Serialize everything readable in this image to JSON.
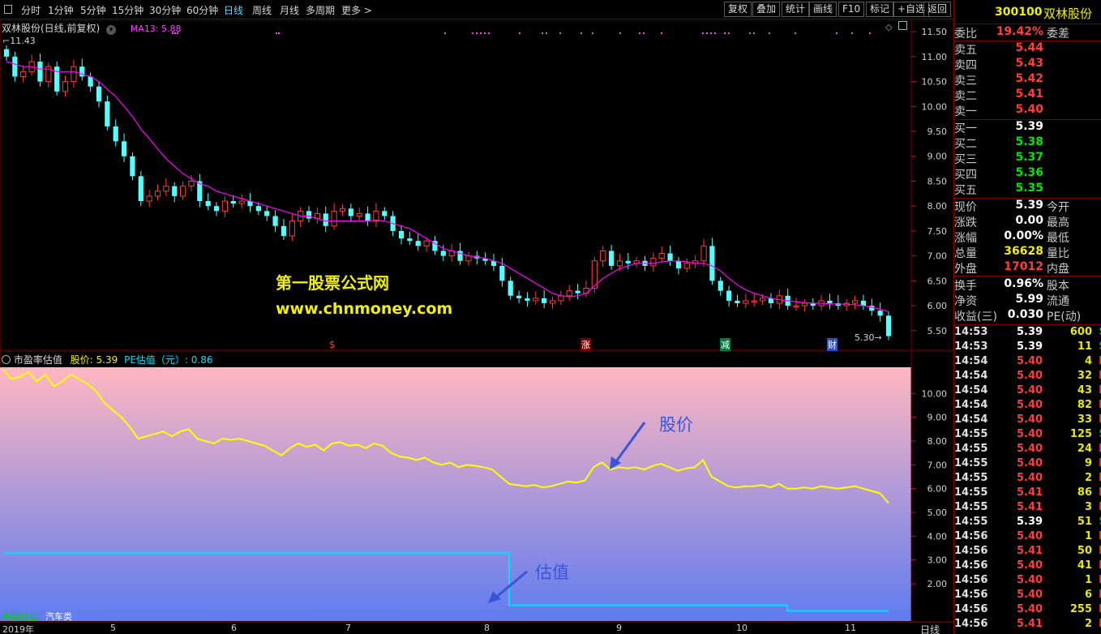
{
  "toolbar": {
    "periods": [
      "分时",
      "1分钟",
      "5分钟",
      "15分钟",
      "30分钟",
      "60分钟",
      "日线",
      "周线",
      "月线",
      "多周期",
      "更多 >"
    ],
    "active_period": "日线",
    "right_buttons": [
      "复权",
      "叠加",
      "统计",
      "画线",
      "F10",
      "标记",
      "+自选",
      "返回"
    ]
  },
  "main_header": {
    "stock_label": "双林股份(日线,前复权)",
    "ma_label": "MA13: 5.88",
    "high_label": "11.43",
    "low_label": "5.30"
  },
  "watermark": {
    "line1": "第一股票公式网",
    "line2": "www.chnmoney.com"
  },
  "event_marks": [
    "$",
    "涨",
    "减",
    "财"
  ],
  "indicator_header": {
    "name": "市盈率估值",
    "price_label": "股价: 5.39",
    "pe_label": "PE估值（元）: 0.86"
  },
  "annotations": {
    "price": "股价",
    "valuation": "估值"
  },
  "industry": {
    "label": "所属行业",
    "value": "汽车类"
  },
  "x_axis": {
    "period": "日线",
    "labels": [
      "2019年",
      "5",
      "6",
      "7",
      "8",
      "9",
      "10",
      "11"
    ]
  },
  "stock_head": {
    "code": "300100",
    "name": "双林股份"
  },
  "weibi": {
    "label": "委比",
    "value": "19.42%",
    "right_label": "委差"
  },
  "asks": [
    {
      "label": "卖五",
      "price": "5.44"
    },
    {
      "label": "卖四",
      "price": "5.43"
    },
    {
      "label": "卖三",
      "price": "5.42"
    },
    {
      "label": "卖二",
      "price": "5.41"
    },
    {
      "label": "卖一",
      "price": "5.40"
    }
  ],
  "bids": [
    {
      "label": "买一",
      "price": "5.39"
    },
    {
      "label": "买二",
      "price": "5.38"
    },
    {
      "label": "买三",
      "price": "5.37"
    },
    {
      "label": "买四",
      "price": "5.36"
    },
    {
      "label": "买五",
      "price": "5.35"
    }
  ],
  "stats": [
    {
      "label": "现价",
      "value": "5.39",
      "right": "今开"
    },
    {
      "label": "涨跌",
      "value": "0.00",
      "right": "最高"
    },
    {
      "label": "涨幅",
      "value": "0.00%",
      "right": "最低"
    },
    {
      "label": "总量",
      "value": "36628",
      "right": "量比"
    },
    {
      "label": "外盘",
      "value": "17012",
      "right": "内盘"
    }
  ],
  "fundamentals": [
    {
      "label": "换手",
      "value": "0.96%",
      "right": "股本"
    },
    {
      "label": "净资",
      "value": "5.99",
      "right": "流通"
    },
    {
      "label": "收益(三)",
      "value": "0.030",
      "right": "PE(动)"
    }
  ],
  "trades": [
    {
      "time": "14:53",
      "price": "5.39",
      "vol": "600",
      "dir": "S"
    },
    {
      "time": "14:53",
      "price": "5.39",
      "vol": "11",
      "dir": "S"
    },
    {
      "time": "14:54",
      "price": "5.40",
      "vol": "4",
      "dir": "B"
    },
    {
      "time": "14:54",
      "price": "5.40",
      "vol": "32",
      "dir": "B"
    },
    {
      "time": "14:54",
      "price": "5.40",
      "vol": "43",
      "dir": "B"
    },
    {
      "time": "14:54",
      "price": "5.40",
      "vol": "82",
      "dir": "B"
    },
    {
      "time": "14:54",
      "price": "5.40",
      "vol": "33",
      "dir": "B"
    },
    {
      "time": "14:55",
      "price": "5.40",
      "vol": "125",
      "dir": "S"
    },
    {
      "time": "14:55",
      "price": "5.40",
      "vol": "24",
      "dir": "B"
    },
    {
      "time": "14:55",
      "price": "5.40",
      "vol": "9",
      "dir": "B"
    },
    {
      "time": "14:55",
      "price": "5.40",
      "vol": "2",
      "dir": "B"
    },
    {
      "time": "14:55",
      "price": "5.41",
      "vol": "86",
      "dir": "B"
    },
    {
      "time": "14:55",
      "price": "5.41",
      "vol": "3",
      "dir": "B"
    },
    {
      "time": "14:55",
      "price": "5.39",
      "vol": "51",
      "dir": "S"
    },
    {
      "time": "14:56",
      "price": "5.40",
      "vol": "1",
      "dir": "B"
    },
    {
      "time": "14:56",
      "price": "5.41",
      "vol": "50",
      "dir": "B"
    },
    {
      "time": "14:56",
      "price": "5.40",
      "vol": "41",
      "dir": "B"
    },
    {
      "time": "14:56",
      "price": "5.40",
      "vol": "1",
      "dir": "B"
    },
    {
      "time": "14:56",
      "price": "5.40",
      "vol": "6",
      "dir": "B"
    },
    {
      "time": "14:56",
      "price": "5.40",
      "vol": "255",
      "dir": "B"
    },
    {
      "time": "14:56",
      "price": "5.41",
      "vol": "2",
      "dir": "B"
    }
  ],
  "colors": {
    "up": "#ff3c3c",
    "down": "#54ffff",
    "ma": "#ff00ff",
    "price_line": "#ffff00",
    "pe_line": "#00e0ff",
    "border": "#7a0000",
    "gradient_top": "#ffb6c1",
    "gradient_bottom": "#5f7cf0"
  },
  "chart_data": [
    {
      "type": "candlestick",
      "title": "双林股份(日线,前复权)",
      "series_name": "MA13",
      "y_ticks": [
        11.5,
        11.0,
        10.5,
        10.0,
        9.5,
        9.0,
        8.5,
        8.0,
        7.5,
        7.0,
        6.5,
        6.0,
        5.5
      ],
      "ylim": [
        5.35,
        11.6
      ],
      "x_labels": [
        "2019年",
        "5",
        "6",
        "7",
        "8",
        "9",
        "10",
        "11"
      ],
      "close": [
        11.0,
        10.6,
        10.7,
        10.9,
        10.5,
        10.8,
        10.3,
        10.5,
        10.8,
        10.6,
        10.4,
        10.1,
        9.6,
        9.3,
        9.0,
        8.6,
        8.1,
        8.2,
        8.3,
        8.4,
        8.2,
        8.4,
        8.5,
        8.1,
        8.0,
        7.9,
        8.1,
        8.05,
        8.1,
        8.0,
        7.9,
        7.8,
        7.6,
        7.4,
        7.7,
        7.9,
        7.75,
        7.85,
        7.6,
        7.9,
        7.95,
        7.8,
        7.85,
        7.7,
        7.9,
        7.8,
        7.5,
        7.35,
        7.3,
        7.2,
        7.3,
        7.1,
        7.0,
        7.1,
        6.9,
        7.0,
        6.95,
        6.9,
        6.8,
        6.5,
        6.2,
        6.15,
        6.1,
        6.15,
        6.05,
        6.1,
        6.2,
        6.3,
        6.25,
        6.35,
        6.9,
        7.1,
        6.8,
        6.9,
        6.85,
        6.9,
        6.8,
        6.95,
        7.05,
        6.9,
        6.75,
        6.85,
        6.9,
        7.2,
        6.5,
        6.3,
        6.1,
        6.05,
        6.1,
        6.1,
        6.15,
        6.05,
        6.2,
        6.0,
        6.0,
        6.05,
        6.0,
        6.1,
        6.05,
        6.0,
        6.05,
        6.1,
        6.0,
        5.9,
        5.8,
        5.39
      ],
      "ma13": [
        10.9,
        10.85,
        10.8,
        10.8,
        10.75,
        10.75,
        10.7,
        10.7,
        10.7,
        10.65,
        10.6,
        10.5,
        10.35,
        10.2,
        10.0,
        9.8,
        9.55,
        9.35,
        9.15,
        8.95,
        8.8,
        8.65,
        8.55,
        8.45,
        8.4,
        8.3,
        8.25,
        8.2,
        8.15,
        8.1,
        8.05,
        8.0,
        7.95,
        7.9,
        7.85,
        7.8,
        7.8,
        7.75,
        7.7,
        7.7,
        7.7,
        7.7,
        7.7,
        7.7,
        7.72,
        7.7,
        7.65,
        7.6,
        7.55,
        7.45,
        7.35,
        7.25,
        7.15,
        7.1,
        7.05,
        7.0,
        6.98,
        6.95,
        6.9,
        6.85,
        6.75,
        6.65,
        6.55,
        6.45,
        6.35,
        6.25,
        6.2,
        6.18,
        6.2,
        6.25,
        6.4,
        6.55,
        6.65,
        6.75,
        6.8,
        6.85,
        6.85,
        6.85,
        6.88,
        6.9,
        6.9,
        6.88,
        6.85,
        6.85,
        6.8,
        6.7,
        6.55,
        6.42,
        6.32,
        6.25,
        6.2,
        6.15,
        6.12,
        6.1,
        6.08,
        6.06,
        6.05,
        6.05,
        6.04,
        6.03,
        6.03,
        6.02,
        6.0,
        5.97,
        5.93,
        5.88
      ]
    },
    {
      "type": "line",
      "title": "市盈率估值",
      "y_ticks": [
        10.0,
        9.0,
        8.0,
        7.0,
        6.0,
        5.0,
        4.0,
        3.0,
        2.0
      ],
      "ylim": [
        0.4,
        11.1
      ],
      "series": [
        {
          "name": "股价",
          "values": [
            11.0,
            10.6,
            10.7,
            10.9,
            10.5,
            10.8,
            10.3,
            10.5,
            10.8,
            10.6,
            10.4,
            10.1,
            9.6,
            9.3,
            9.0,
            8.6,
            8.1,
            8.2,
            8.3,
            8.4,
            8.2,
            8.4,
            8.5,
            8.1,
            8.0,
            7.9,
            8.1,
            8.05,
            8.1,
            8.0,
            7.9,
            7.8,
            7.6,
            7.4,
            7.7,
            7.9,
            7.75,
            7.85,
            7.6,
            7.9,
            7.95,
            7.8,
            7.85,
            7.7,
            7.9,
            7.8,
            7.5,
            7.35,
            7.3,
            7.2,
            7.3,
            7.1,
            7.0,
            7.1,
            6.9,
            7.0,
            6.95,
            6.9,
            6.8,
            6.5,
            6.2,
            6.15,
            6.1,
            6.15,
            6.05,
            6.1,
            6.2,
            6.3,
            6.25,
            6.35,
            6.9,
            7.1,
            6.8,
            6.9,
            6.85,
            6.9,
            6.8,
            6.95,
            7.05,
            6.9,
            6.75,
            6.85,
            6.9,
            7.2,
            6.5,
            6.3,
            6.1,
            6.05,
            6.1,
            6.1,
            6.15,
            6.05,
            6.2,
            6.0,
            6.0,
            6.05,
            6.0,
            6.1,
            6.05,
            6.0,
            6.05,
            6.1,
            6.0,
            5.9,
            5.8,
            5.39
          ]
        },
        {
          "name": "PE估值（元）",
          "values": [
            3.3,
            3.3,
            3.3,
            3.3,
            3.3,
            3.3,
            3.3,
            3.3,
            3.3,
            3.3,
            3.3,
            3.3,
            3.3,
            3.3,
            3.3,
            3.3,
            3.3,
            3.3,
            3.3,
            3.3,
            3.3,
            3.3,
            3.3,
            3.3,
            3.3,
            3.3,
            3.3,
            3.3,
            3.3,
            3.3,
            3.3,
            3.3,
            3.3,
            3.3,
            3.3,
            3.3,
            3.3,
            3.3,
            3.3,
            3.3,
            3.3,
            3.3,
            3.3,
            3.3,
            3.3,
            3.3,
            3.3,
            3.3,
            3.3,
            3.3,
            3.3,
            3.3,
            3.3,
            3.3,
            3.3,
            3.3,
            3.3,
            3.3,
            3.3,
            3.3,
            1.1,
            1.1,
            1.1,
            1.1,
            1.1,
            1.1,
            1.1,
            1.1,
            1.1,
            1.1,
            1.1,
            1.1,
            1.1,
            1.1,
            1.1,
            1.1,
            1.1,
            1.1,
            1.1,
            1.1,
            1.1,
            1.1,
            1.1,
            1.1,
            1.1,
            1.1,
            1.1,
            1.1,
            1.1,
            1.1,
            1.1,
            1.1,
            1.1,
            0.86,
            0.86,
            0.86,
            0.86,
            0.86,
            0.86,
            0.86,
            0.86,
            0.86,
            0.86,
            0.86,
            0.86,
            0.86
          ]
        }
      ]
    }
  ]
}
